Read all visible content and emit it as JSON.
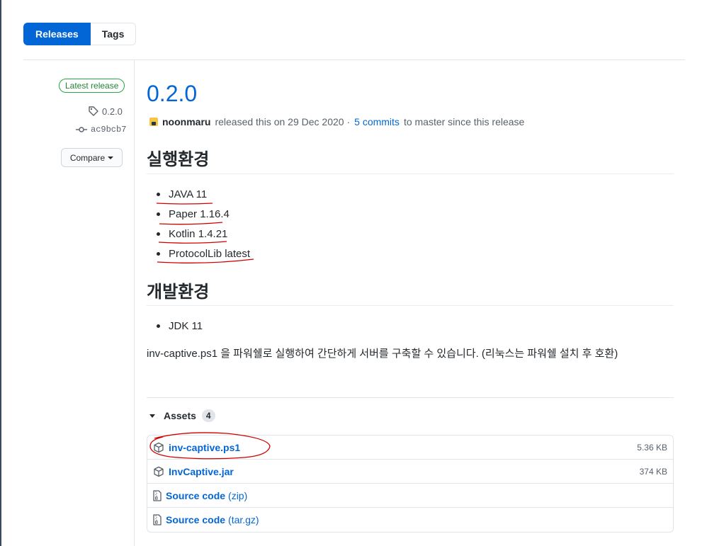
{
  "tabs": [
    {
      "label": "Releases",
      "active": true
    },
    {
      "label": "Tags",
      "active": false
    }
  ],
  "sidebar": {
    "latest_badge": "Latest release",
    "tag": "0.2.0",
    "commit": "ac9bcb7",
    "compare_label": "Compare"
  },
  "release": {
    "title": "0.2.0",
    "author": "noonmaru",
    "released_text": "released this on 29 Dec 2020 ·",
    "commits_link": "5 commits",
    "since_text": "to master since this release"
  },
  "body": {
    "heading_runtime": "실행환경",
    "runtime_items": [
      "JAVA 11",
      "Paper 1.16.4",
      "Kotlin 1.4.21",
      "ProtocolLib latest"
    ],
    "heading_dev": "개발환경",
    "dev_items": [
      "JDK 11"
    ],
    "paragraph": "inv-captive.ps1 을 파워쉘로 실행하여 간단하게 서버를 구축할 수 있습니다. (리눅스는 파워쉘 설치 후 호환)"
  },
  "assets": {
    "label": "Assets",
    "count": "4",
    "items": [
      {
        "name": "inv-captive.ps1",
        "ext": "",
        "size": "5.36 KB",
        "icon": "package-icon"
      },
      {
        "name": "InvCaptive.jar",
        "ext": "",
        "size": "374 KB",
        "icon": "package-icon"
      },
      {
        "name": "Source code",
        "ext": "(zip)",
        "size": "",
        "icon": "file-zip-icon"
      },
      {
        "name": "Source code",
        "ext": "(tar.gz)",
        "size": "",
        "icon": "file-zip-icon"
      }
    ]
  },
  "colors": {
    "link": "#0366d6",
    "badge_green": "#28a745",
    "annotation_red": "#d10000"
  }
}
